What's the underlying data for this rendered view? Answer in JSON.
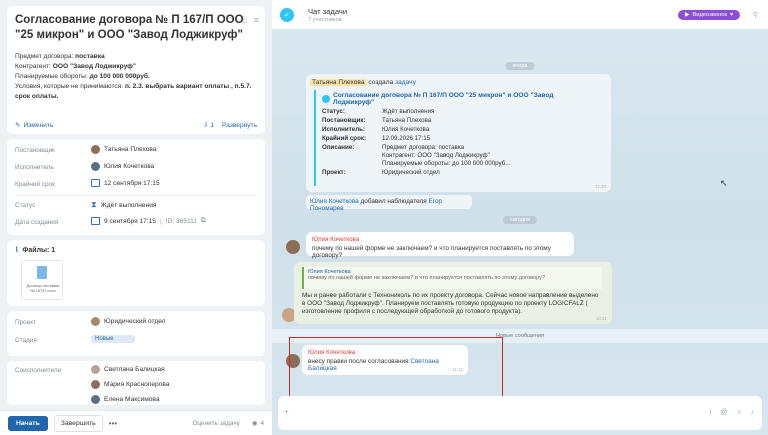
{
  "task": {
    "title": "Согласование договора № П 167/П ООО \"25 микрон\" и ООО \"Завод Лоджикруф\"",
    "description": [
      {
        "label": "Предмет договора:",
        "value": "поставка"
      },
      {
        "label": "Контрагент:",
        "value": "ООО \"Завод Лоджикруф\""
      },
      {
        "label": "Планируемые обороты:",
        "value": "до 100 000 000руб."
      },
      {
        "label": "Условия, которые не принимаются:",
        "value": "п. 2.3. выбрать вариант оплаты , п.5.7. срок оплаты."
      }
    ],
    "edit_label": "Изменить",
    "subtasks_count": "1",
    "expand_label": "Развернуть"
  },
  "people": {
    "creator_label": "Постановщик",
    "creator": "Татьяна Плехова",
    "assignee_label": "Исполнитель",
    "assignee": "Юлия Кочеткова",
    "deadline_label": "Крайний срок",
    "deadline": "12 сентября 17:15",
    "status_label": "Статус",
    "status": "Ждёт выполнения",
    "created_label": "Дата создания",
    "created": "9 сентября 17:15",
    "id_text": "ID: 365111"
  },
  "files": {
    "title": "Файлы: 1",
    "file_name": "Договор поставки № 167/П.docx"
  },
  "project": {
    "project_label": "Проект",
    "project": "Юридический отдел",
    "stage_label": "Стадия",
    "stage": "Новые"
  },
  "coexecutors": {
    "label": "Соисполнители",
    "list": [
      "Светлана Балицкая",
      "Мария Красноперова",
      "Елена Максимова"
    ]
  },
  "bottom": {
    "start": "Начать",
    "finish": "Завершить",
    "more": "•••",
    "rate": "Оценить задачу",
    "views": "4"
  },
  "chat": {
    "title": "Чат задачи",
    "subtitle": "7 участников",
    "video_button": "Видеозвонок",
    "date_yesterday": "вчера",
    "date_today": "сегодня",
    "task_card": {
      "creator": "Татьяна Плехова",
      "created_text": "создала",
      "created_link": "задачу",
      "task_name": "Согласование договора № П 167/П ООО \"25 микрон\" и ООО \"Завод Лоджикруф\"",
      "status_k": "Статус:",
      "status_v": "Ждёт выполнения",
      "creator_k": "Постановщик:",
      "creator_v": "Татьяна Плехова",
      "assignee_k": "Исполнитель:",
      "assignee_v": "Юлия Кочеткова",
      "deadline_k": "Крайний срок:",
      "deadline_v": "12.09.2026 17:15",
      "desc_k": "Описание:",
      "desc_v1": "Предмет договора: поставка",
      "desc_v2": "Контрагент: ООО \"Завод Лоджикруф\"",
      "desc_v3": "Планируемые обороты: до 100 000 000руб...",
      "project_k": "Проект:",
      "project_v": "Юридический отдел",
      "time": "17:24"
    },
    "watcher": {
      "who": "Юлия Кочеткова",
      "action": "добавил наблюдателя",
      "whom": "Егор Пономарев"
    },
    "msg1": {
      "author": "Юлия Кочеткова",
      "text": "почему по нашей форме не заключаем? и что планируется поставлять по этому договору?"
    },
    "msg2": {
      "quote_author": "Юлия Кочеткова",
      "quote_text": "почему по нашей форме не заключаем? и что планируется поставлять по этому договору?",
      "text": "Мы и ранее работали с Технониколь по их проекту договора. Сейчас новое направление выделено в ООО \"Завод Лоджикруф\". Планируем поставлять готовую продукцию по проекту LOGICFALZ ( изготовление профиля с последующей обработкой до готового продукта).",
      "time": "10:21"
    },
    "new_messages": "Новые сообщения",
    "msg3": {
      "author": "Юлия Кочеткова",
      "text": "внесу правки после согласования",
      "mention": "Светлана Балицкая",
      "time": "11:12"
    },
    "input_placeholder": ""
  },
  "colors": {
    "accent": "#2067b0",
    "chat_icon": "#2fc6f6",
    "video_button": "#8c4fd4",
    "highlight": "#d2262b",
    "author": "#e0423a"
  }
}
